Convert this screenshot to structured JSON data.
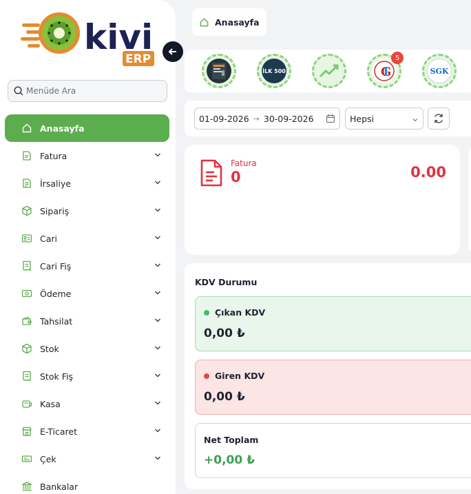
{
  "brand": {
    "name": "kivi",
    "sub": "ERP",
    "colors": {
      "primary_green": "#5cad4d",
      "navy": "#1e2356",
      "orange": "#e58a2f",
      "red": "#e0323f"
    }
  },
  "sidebar": {
    "search_placeholder": "Menüde Ara",
    "items": [
      {
        "label": "Anasayfa",
        "icon": "home-icon",
        "active": true,
        "has_children": false
      },
      {
        "label": "Fatura",
        "icon": "invoice-icon",
        "active": false,
        "has_children": true
      },
      {
        "label": "İrsaliye",
        "icon": "waybill-icon",
        "active": false,
        "has_children": true
      },
      {
        "label": "Sipariş",
        "icon": "box-icon",
        "active": false,
        "has_children": true
      },
      {
        "label": "Cari",
        "icon": "id-card-icon",
        "active": false,
        "has_children": true
      },
      {
        "label": "Cari Fiş",
        "icon": "receipt-icon",
        "active": false,
        "has_children": true
      },
      {
        "label": "Ödeme",
        "icon": "money-icon",
        "active": false,
        "has_children": true
      },
      {
        "label": "Tahsilat",
        "icon": "wallet-icon",
        "active": false,
        "has_children": true
      },
      {
        "label": "Stok",
        "icon": "box-icon",
        "active": false,
        "has_children": true
      },
      {
        "label": "Stok Fiş",
        "icon": "receipt-icon",
        "active": false,
        "has_children": true
      },
      {
        "label": "Kasa",
        "icon": "cash-register-icon",
        "active": false,
        "has_children": true
      },
      {
        "label": "E-Ticaret",
        "icon": "store-icon",
        "active": false,
        "has_children": true
      },
      {
        "label": "Çek",
        "icon": "cheque-icon",
        "active": false,
        "has_children": true
      },
      {
        "label": "Bankalar",
        "icon": "bank-icon",
        "active": false,
        "has_children": false
      }
    ]
  },
  "breadcrumb": {
    "label": "Anasayfa"
  },
  "quick_links": [
    {
      "name": "app-tile-1",
      "badge": null
    },
    {
      "name": "ilk-500-tile",
      "text": "İLK 500",
      "badge": null
    },
    {
      "name": "growth-chart-tile",
      "badge": null
    },
    {
      "name": "gib-tile",
      "badge": "5"
    },
    {
      "name": "sgk-tile",
      "text": "SGK",
      "badge": null
    }
  ],
  "filters": {
    "start_date": "01-09-2026",
    "end_date": "30-09-2026",
    "type_selected": "Hepsi"
  },
  "summary_card": {
    "label": "Fatura",
    "count": "0",
    "amount": "0.00"
  },
  "kdv": {
    "title": "KDV Durumu",
    "out_label": "Çıkan KDV",
    "out_value": "0,00 ₺",
    "in_label": "Giren KDV",
    "in_value": "0,00 ₺",
    "net_label": "Net Toplam",
    "net_value": "+0,00 ₺"
  }
}
